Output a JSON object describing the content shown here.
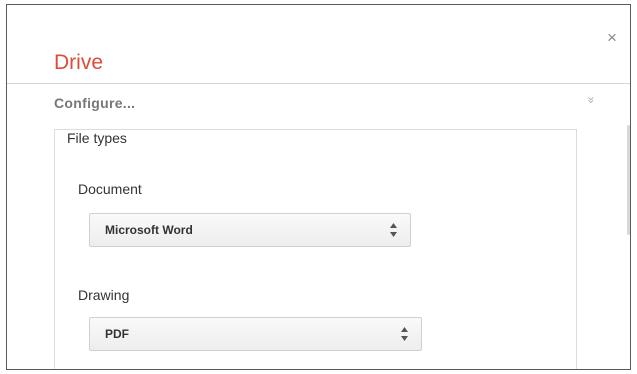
{
  "dialog": {
    "title": "Drive",
    "close_icon": "close-icon",
    "close_glyph": "×"
  },
  "configure": {
    "label": "Configure...",
    "expander_glyph": "»"
  },
  "file_types": {
    "legend": "File types",
    "document": {
      "label": "Document",
      "selected": "Microsoft Word"
    },
    "drawing": {
      "label": "Drawing",
      "selected": "PDF"
    }
  },
  "colors": {
    "title": "#dd4b39",
    "border": "#5a5a5a"
  }
}
